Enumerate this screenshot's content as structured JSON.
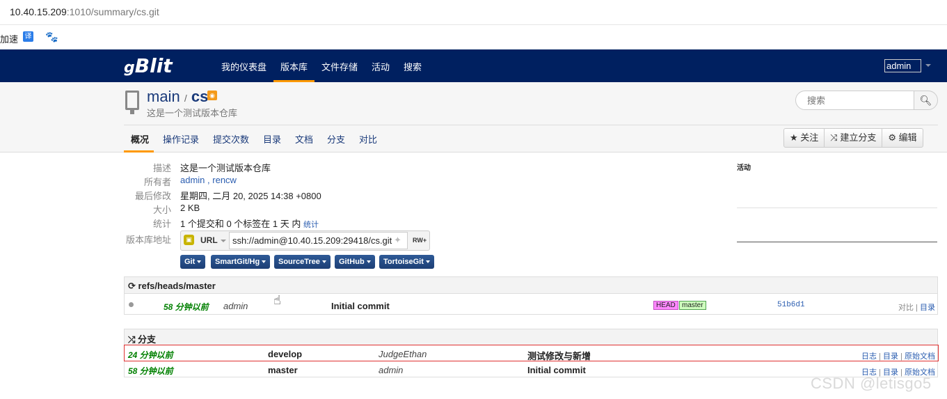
{
  "browser": {
    "url_host": "10.40.15.209",
    "url_rest": ":1010/summary/cs.git",
    "bookmark_text": "加速",
    "bookmark_fanyi": "译",
    "bookmark_baidu": "🐾"
  },
  "navbar": {
    "brand": "Blit",
    "brand_prefix": "g",
    "items": [
      "我的仪表盘",
      "版本库",
      "文件存储",
      "活动",
      "搜索"
    ],
    "active_item": "版本库",
    "user": "admin"
  },
  "repo": {
    "project": "main",
    "separator": "/",
    "name": "cs",
    "description": "这是一个测试版本仓库",
    "search_placeholder": "搜索",
    "tabs": [
      "概况",
      "操作记录",
      "提交次数",
      "目录",
      "文档",
      "分支",
      "对比"
    ],
    "active_tab": "概况",
    "actions": [
      {
        "icon": "star-icon",
        "label": "关注"
      },
      {
        "icon": "fork-icon",
        "label": "建立分支"
      },
      {
        "icon": "gear-icon",
        "label": "编辑"
      }
    ]
  },
  "summary": {
    "labels": {
      "description": "描述",
      "owners": "所有者",
      "last_change": "最后修改",
      "size": "大小",
      "stats": "统计",
      "repo_url": "版本库地址"
    },
    "description": "这是一个测试版本仓库",
    "owners": [
      "admin",
      "rencw"
    ],
    "owners_sep": " , ",
    "last_change": "星期四, 二月 20, 2025 14:38 +0800",
    "size": "2 KB",
    "stats_text": "1 个提交和 0 个标签在 1 天 内",
    "stats_link": "统计",
    "url_protocol": "URL",
    "url": "ssh://admin@10.40.15.209:29418/cs.git",
    "permission": "RW+",
    "clients": [
      "Git",
      "SmartGit/Hg",
      "SourceTree",
      "GitHub",
      "TortoiseGit"
    ],
    "activity_title": "活动"
  },
  "refs": {
    "title": "refs/heads/master",
    "commit": {
      "age": "58 分钟以前",
      "author": "admin",
      "message": "Initial commit",
      "tags": [
        "HEAD",
        "master"
      ],
      "sha": "51b6d1",
      "link_compare": "对比",
      "link_tree": "目录",
      "link_sep": " | "
    }
  },
  "branches": {
    "title": "分支",
    "rows": [
      {
        "age": "24 分钟以前",
        "name": "develop",
        "author": "JudgeEthan",
        "message": "测试修改与新增",
        "log": "日志",
        "tree": "目录",
        "docs": "原始文档"
      },
      {
        "age": "58 分钟以前",
        "name": "master",
        "author": "admin",
        "message": "Initial commit",
        "log": "日志",
        "tree": "目录",
        "docs": "原始文档"
      }
    ],
    "link_sep": " | "
  },
  "watermark": "CSDN @letisgo5"
}
